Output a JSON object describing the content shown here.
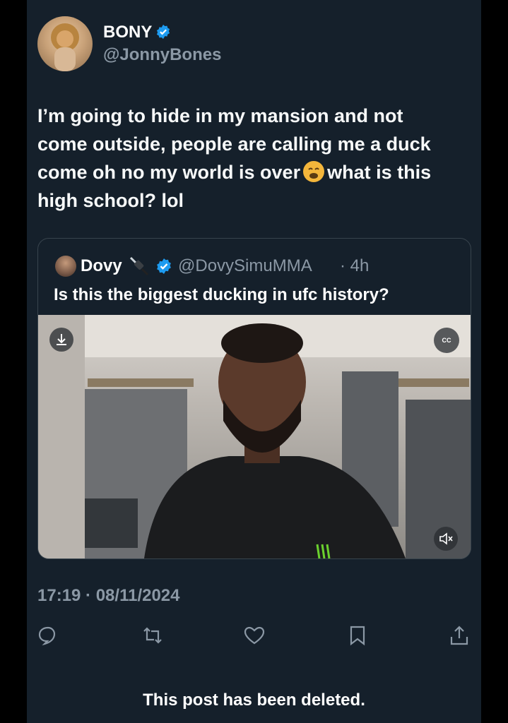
{
  "tweet": {
    "display_name": "BONY",
    "handle": "@JonnyBones",
    "text_lines": [
      "I’m going to hide in my mansion and not",
      "come outside, people are calling me a duck",
      "come oh no my world is over",
      "what is this",
      "high school? lol"
    ],
    "emoji": "weary-face-emoji",
    "timestamp": "17:19 · 08/11/2024"
  },
  "quote": {
    "display_name": "Dovy",
    "name_emoji": "plug-icon",
    "handle": "@DovySimuMMA",
    "time": "· 4h",
    "text": "Is this the biggest ducking in ufc history?",
    "video": {
      "download_icon": "download-icon",
      "captions_label": "CC",
      "mute_icon": "mute-icon"
    }
  },
  "actions": [
    {
      "icon": "reply-icon"
    },
    {
      "icon": "retweet-icon"
    },
    {
      "icon": "like-icon"
    },
    {
      "icon": "bookmark-icon"
    },
    {
      "icon": "share-icon"
    }
  ],
  "footer": {
    "deleted_notice": "This post has been deleted."
  },
  "colors": {
    "background": "#15202b",
    "muted": "#8b98a5",
    "verified": "#1d9bf0"
  }
}
